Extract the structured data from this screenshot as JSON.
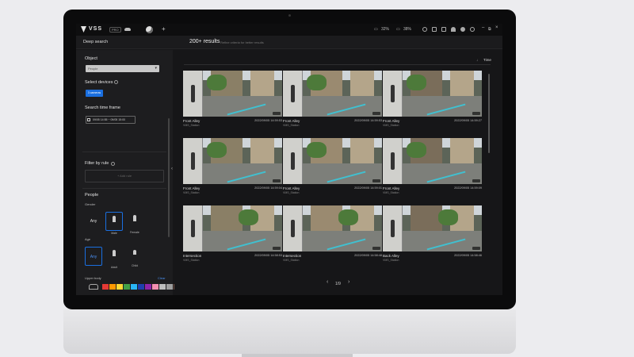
{
  "topbar": {
    "brand": "VSS",
    "badge": "PRO",
    "cpu": "32%",
    "mem": "38%",
    "icons": [
      "search-icon",
      "grid-icon",
      "monitor-icon",
      "bell-icon",
      "gear-icon",
      "user-icon",
      "minimize-icon",
      "restore-icon",
      "close-icon"
    ]
  },
  "header": {
    "title": "Deep search",
    "result_count": "200+ results",
    "result_hint": "Refine criteria for better results"
  },
  "sidebar": {
    "object_label": "Object",
    "object_value": "People",
    "devices_label": "Select devices",
    "devices_button": "3 cameras",
    "time_label": "Search time frame",
    "time_value": "09/05 14:55 ~ 09/05 15:00",
    "filter_label": "Filter by rule",
    "add_rule": "+ Add rule",
    "people_label": "People",
    "gender_label": "Gender",
    "gender_options": [
      "Any",
      "Male",
      "Female"
    ],
    "age_label": "Age",
    "age_options": [
      "Any",
      "Adult",
      "Child"
    ],
    "upper_body_label": "Upper body",
    "clear_label": "Clear",
    "colors": [
      "#e53935",
      "#ff9800",
      "#fdd835",
      "#43a047",
      "#29b6f6",
      "#1e3fae",
      "#8e24aa",
      "#f48fb1",
      "#bdbdbd",
      "#9e9e9e",
      "#795548"
    ]
  },
  "main": {
    "sort_label": "Time",
    "page": "1/9",
    "cards": [
      {
        "camera": "Front Alley",
        "source": "VMS_Station",
        "timestamp": "2022/09/05 14:59:53"
      },
      {
        "camera": "Front Alley",
        "source": "VMS_Station",
        "timestamp": "2022/09/05 14:59:53"
      },
      {
        "camera": "Front Alley",
        "source": "VMS_Station",
        "timestamp": "2022/09/05 14:59:27"
      },
      {
        "camera": "Front Alley",
        "source": "VMS_Station",
        "timestamp": "2022/09/05 14:59:04"
      },
      {
        "camera": "Front Alley",
        "source": "VMS_Station",
        "timestamp": "2022/09/05 14:59:01"
      },
      {
        "camera": "Front Alley",
        "source": "VMS_Station",
        "timestamp": "2022/09/05 14:59:09"
      },
      {
        "camera": "Intersection",
        "source": "VMS_Station",
        "timestamp": "2022/09/05 14:58:53"
      },
      {
        "camera": "Intersection",
        "source": "VMS_Station",
        "timestamp": "2022/09/05 14:58:48"
      },
      {
        "camera": "Back Alley",
        "source": "VMS_Station",
        "timestamp": "2022/09/05 14:58:46"
      }
    ]
  }
}
